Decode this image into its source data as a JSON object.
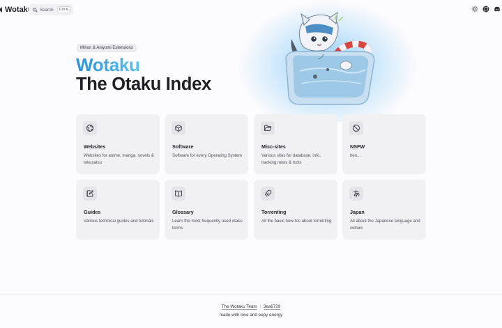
{
  "nav": {
    "brand": "Wotaku",
    "search_label": "Search",
    "search_shortcut": "Ctrl K",
    "icons": [
      "sun-icon",
      "github-icon",
      "discord-icon"
    ]
  },
  "hero": {
    "tagline": "Mihon & Aniyomi Extensions",
    "title_name": "Wotaku",
    "title_sub": "The Otaku Index",
    "accent_color": "#3fa9e6"
  },
  "cards": [
    {
      "icon": "globe-icon",
      "title": "Websites",
      "desc": "Websites for anime, manga, novels & tokusatsu"
    },
    {
      "icon": "cube-icon",
      "title": "Software",
      "desc": "Software for every Operating System"
    },
    {
      "icon": "folder-icon",
      "title": "Misc-sites",
      "desc": "Various sites for database, info, tracking news & tools"
    },
    {
      "icon": "block-icon",
      "title": "NSFW",
      "desc": "hen..."
    },
    {
      "icon": "notebook-pen-icon",
      "title": "Guides",
      "desc": "Various technical guides and tutorials"
    },
    {
      "icon": "book-open-icon",
      "title": "Glossary",
      "desc": "Learn the most frequently used otaku terms"
    },
    {
      "icon": "magnet-icon",
      "title": "Torrenting",
      "desc": "All the basic how-tos about torrenting"
    },
    {
      "icon": "hiragana-a-icon",
      "title": "Japan",
      "desc": "All about the Japanese language and culture"
    }
  ],
  "footer": {
    "team": "The Wotaku Team",
    "commit": "3ea6729",
    "tagline": "made with love and eepy energy"
  }
}
